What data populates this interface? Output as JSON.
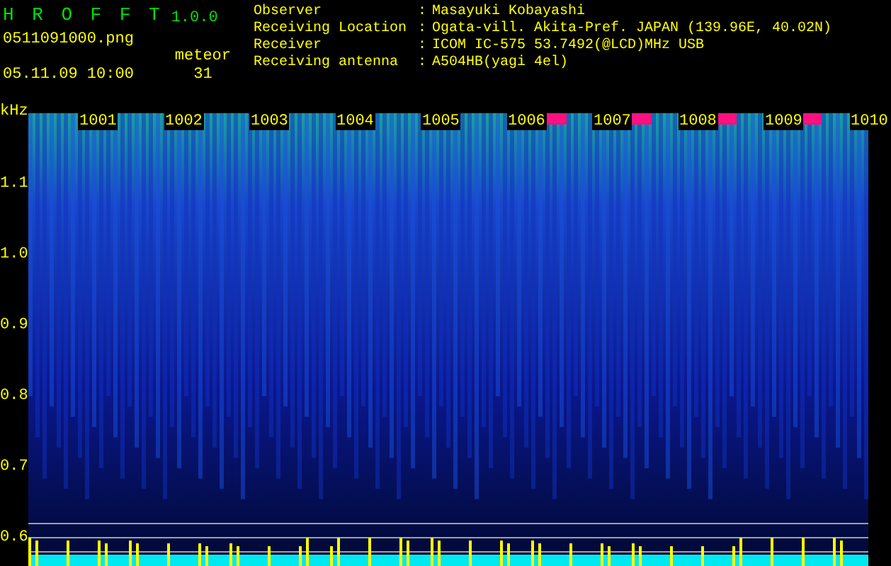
{
  "header": {
    "title": "H R O F F T",
    "version": "1.0.0",
    "filename": "0511091000.png",
    "datetime": "05.11.09 10:00",
    "meteor_label": "meteor",
    "meteor_count": "31"
  },
  "info": [
    {
      "label": "Observer",
      "separator": ":",
      "value": "Masayuki Kobayashi"
    },
    {
      "label": "Receiving Location",
      "separator": ":",
      "value": "Ogata-vill. Akita-Pref. JAPAN (139.96E, 40.02N)"
    },
    {
      "label": "Receiver",
      "separator": ":",
      "value": "ICOM IC-575 53.7492(@LCD)MHz USB"
    },
    {
      "label": "Receiving antenna",
      "separator": ":",
      "value": "A504HB(yagi 4el)"
    }
  ],
  "spectrogram": {
    "unit": "kHz",
    "time_labels": [
      "1001",
      "1002",
      "1003",
      "1004",
      "1005",
      "1006",
      "1007",
      "1008",
      "1009",
      "1010"
    ],
    "freq_labels": [
      "1.1",
      "1.0",
      "0.9",
      "0.8",
      "0.7",
      "0.6"
    ]
  }
}
